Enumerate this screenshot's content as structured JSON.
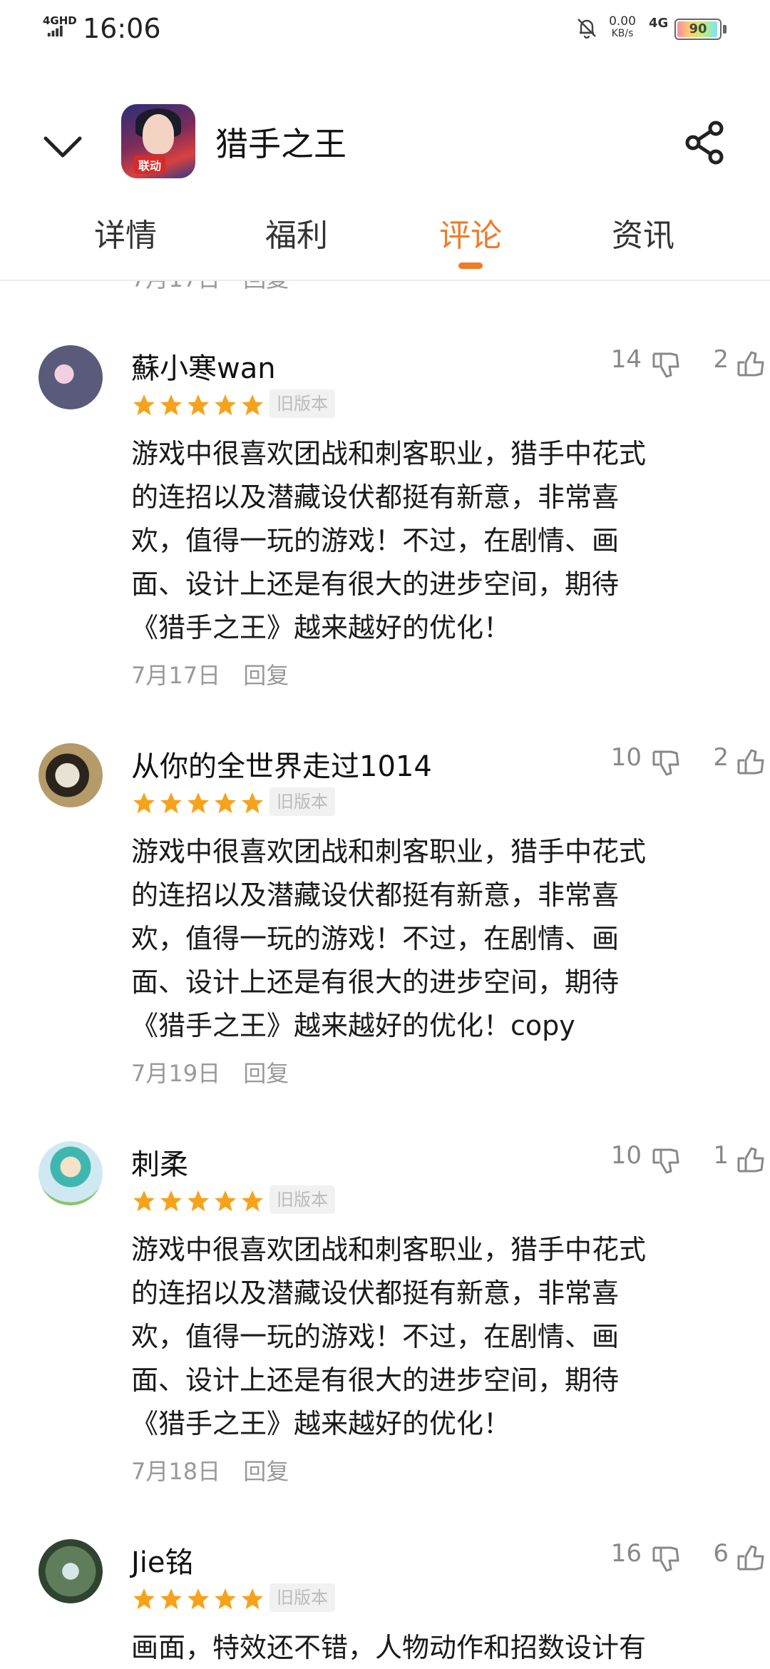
{
  "status_bar": {
    "network_label": "4GHD",
    "time": "16:06",
    "speed_value": "0.00",
    "speed_unit": "KB/s",
    "network_type": "4G",
    "battery_level": "90"
  },
  "header": {
    "app_title": "猎手之王",
    "app_icon_badge": "联动"
  },
  "tabs": [
    {
      "label": "详情",
      "active": false
    },
    {
      "label": "福利",
      "active": false
    },
    {
      "label": "评论",
      "active": true
    },
    {
      "label": "资讯",
      "active": false
    }
  ],
  "partial_meta": {
    "date": "7月17日",
    "reply": "回复"
  },
  "comments": [
    {
      "username": "蘇小寒wan",
      "dislikes": "14",
      "likes": "2",
      "stars": 5,
      "tag": "旧版本",
      "body_lines": [
        "游戏中很喜欢团战和刺客职业，猎手中花式",
        "的连招以及潜藏设伏都挺有新意，非常喜",
        "欢，值得一玩的游戏！不过，在剧情、画",
        "面、设计上还是有很大的进步空间，期待",
        "《猎手之王》越来越好的优化！"
      ],
      "date": "7月17日",
      "reply": "回复"
    },
    {
      "username": "从你的全世界走过1014",
      "dislikes": "10",
      "likes": "2",
      "stars": 5,
      "tag": "旧版本",
      "body_lines": [
        "游戏中很喜欢团战和刺客职业，猎手中花式",
        "的连招以及潜藏设伏都挺有新意，非常喜",
        "欢，值得一玩的游戏！不过，在剧情、画",
        "面、设计上还是有很大的进步空间，期待",
        "《猎手之王》越来越好的优化！copy"
      ],
      "date": "7月19日",
      "reply": "回复"
    },
    {
      "username": "刺柔",
      "dislikes": "10",
      "likes": "1",
      "stars": 5,
      "tag": "旧版本",
      "body_lines": [
        "游戏中很喜欢团战和刺客职业，猎手中花式",
        "的连招以及潜藏设伏都挺有新意，非常喜",
        "欢，值得一玩的游戏！不过，在剧情、画",
        "面、设计上还是有很大的进步空间，期待",
        "《猎手之王》越来越好的优化！"
      ],
      "date": "7月18日",
      "reply": "回复"
    },
    {
      "username": "Jie铭",
      "dislikes": "16",
      "likes": "6",
      "stars": 5,
      "tag": "旧版本",
      "body_lines": [
        "画面，特效还不错，人物动作和招数设计有"
      ],
      "date": "",
      "reply": ""
    }
  ],
  "colors": {
    "accent": "#f07a28",
    "star": "#f7a21b",
    "muted": "#999999"
  },
  "icons": {
    "back": "chevron-down-icon",
    "share": "share-icon",
    "dislike": "thumbs-down-icon",
    "like": "thumbs-up-icon",
    "star": "star-icon",
    "mute": "bell-off-icon"
  }
}
